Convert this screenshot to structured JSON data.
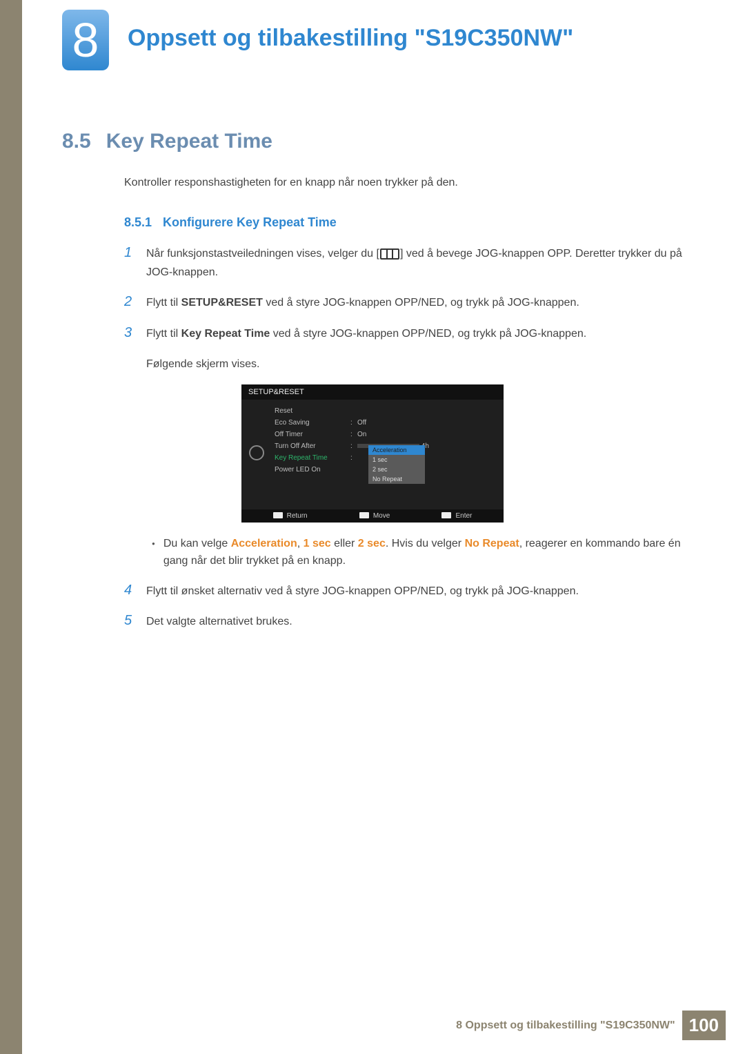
{
  "chapter": {
    "number": "8",
    "title": "Oppsett og tilbakestilling \"S19C350NW\""
  },
  "section": {
    "number": "8.5",
    "title": "Key Repeat Time"
  },
  "intro": "Kontroller responshastigheten for en knapp når noen trykker på den.",
  "subsection": {
    "number": "8.5.1",
    "title": "Konfigurere Key Repeat Time"
  },
  "steps": {
    "s1_a": "Når funksjonstastveiledningen vises, velger du [",
    "s1_b": "] ved å bevege JOG-knappen OPP. Deretter trykker du på JOG-knappen.",
    "s2_a": "Flytt til ",
    "s2_bold": "SETUP&RESET",
    "s2_b": " ved å styre JOG-knappen OPP/NED, og trykk på JOG-knappen.",
    "s3_a": "Flytt til ",
    "s3_bold": "Key Repeat Time",
    "s3_b": " ved å styre JOG-knappen OPP/NED, og trykk på JOG-knappen.",
    "s3_follow": "Følgende skjerm vises.",
    "s4": "Flytt til ønsket alternativ ved å styre JOG-knappen OPP/NED, og trykk på JOG-knappen.",
    "s5": "Det valgte alternativet brukes."
  },
  "step_nums": {
    "n1": "1",
    "n2": "2",
    "n3": "3",
    "n4": "4",
    "n5": "5"
  },
  "bullet": {
    "pre": "Du kan velge ",
    "opt1": "Acceleration",
    "sep1": ", ",
    "opt2": "1 sec",
    "sep2": " eller ",
    "opt3": "2 sec",
    "mid": ". Hvis du velger ",
    "opt4": "No Repeat",
    "post": ", reagerer en kommando bare én gang når det blir trykket på en knapp."
  },
  "osd": {
    "header": "SETUP&RESET",
    "rows": {
      "reset": "Reset",
      "eco": "Eco Saving",
      "eco_val": "Off",
      "off_timer": "Off Timer",
      "off_timer_val": "On",
      "turn_off": "Turn Off After",
      "turn_off_val": "4h",
      "krt": "Key Repeat Time",
      "led": "Power LED On"
    },
    "popup": {
      "p1": "Acceleration",
      "p2": "1 sec",
      "p3": "2 sec",
      "p4": "No Repeat"
    },
    "footer": {
      "return": "Return",
      "move": "Move",
      "enter": "Enter"
    }
  },
  "footer": {
    "text": "8 Oppsett og tilbakestilling \"S19C350NW\"",
    "page": "100"
  }
}
